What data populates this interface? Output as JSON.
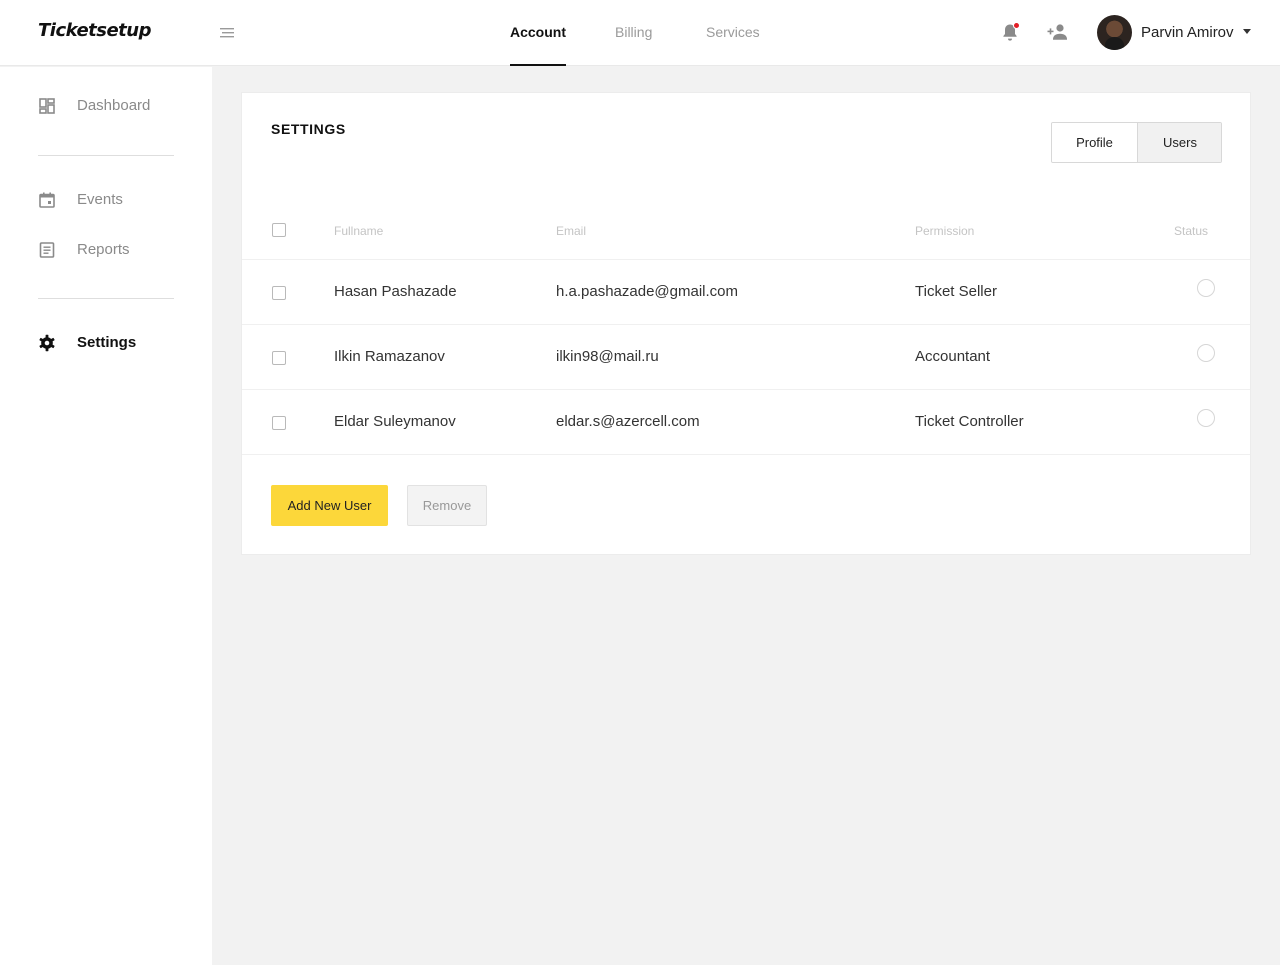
{
  "app": {
    "logo": "Ticketsetup"
  },
  "header": {
    "tabs": [
      {
        "label": "Account",
        "active": true
      },
      {
        "label": "Billing",
        "active": false
      },
      {
        "label": "Services",
        "active": false
      }
    ],
    "user": {
      "name": "Parvin Amirov"
    },
    "notification_dot_color": "#e21e26"
  },
  "sidebar": {
    "items": [
      {
        "label": "Dashboard",
        "icon": "dashboard-icon",
        "active": false
      },
      {
        "label": "Events",
        "icon": "calendar-icon",
        "active": false
      },
      {
        "label": "Reports",
        "icon": "document-icon",
        "active": false
      },
      {
        "label": "Settings",
        "icon": "gear-icon",
        "active": true
      }
    ]
  },
  "settings": {
    "title": "SETTINGS",
    "segment": {
      "profile": "Profile",
      "users": "Users",
      "selected": "Users"
    },
    "table": {
      "headers": {
        "fullname": "Fullname",
        "email": "Email",
        "permission": "Permission",
        "status": "Status"
      },
      "rows": [
        {
          "fullname": "Hasan Pashazade",
          "email": "h.a.pashazade@gmail.com",
          "permission": "Ticket Seller"
        },
        {
          "fullname": "Ilkin Ramazanov",
          "email": "ilkin98@mail.ru",
          "permission": "Accountant"
        },
        {
          "fullname": "Eldar Suleymanov",
          "email": "eldar.s@azercell.com",
          "permission": "Ticket Controller"
        }
      ]
    },
    "buttons": {
      "add": "Add New User",
      "remove": "Remove"
    }
  },
  "colors": {
    "accent": "#fcd73a",
    "background": "#f2f2f2"
  }
}
